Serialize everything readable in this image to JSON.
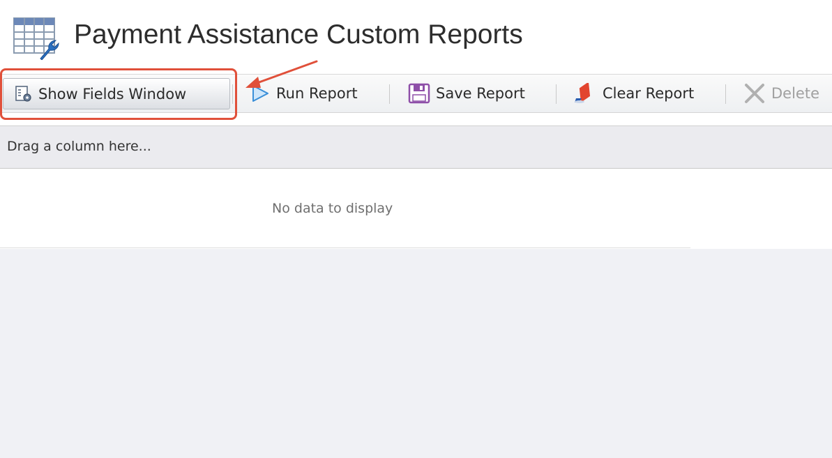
{
  "header": {
    "title": "Payment Assistance Custom Reports",
    "icon": "report-table-wrench-icon"
  },
  "toolbar": {
    "show_fields_label": "Show Fields Window",
    "run_report_label": "Run Report",
    "save_report_label": "Save Report",
    "clear_report_label": "Clear Report",
    "delete_label": "Delete"
  },
  "grid": {
    "group_panel_text": "Drag a column here...",
    "empty_text": "No data to display"
  },
  "colors": {
    "highlight": "#e0503a",
    "run_icon": "#3a8fd8",
    "save_icon": "#8e4fa8",
    "clear_icon": "#e2452f",
    "delete_icon": "#b0b0b0"
  }
}
